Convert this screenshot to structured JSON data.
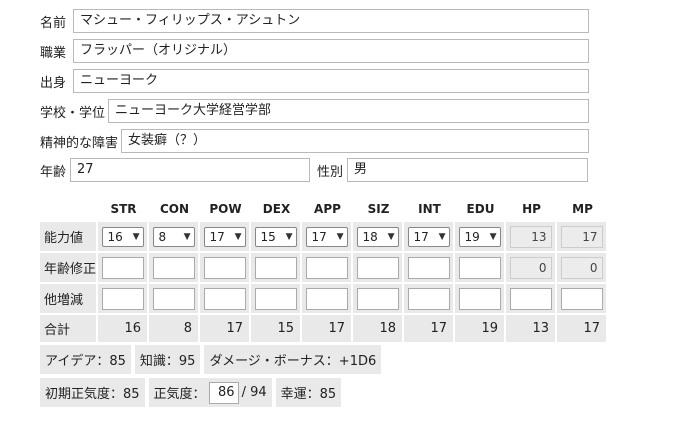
{
  "profile": {
    "name_label": "名前",
    "name_value": "マシュー・フィリップス・アシュトン",
    "job_label": "職業",
    "job_value": "フラッパー（オリジナル）",
    "origin_label": "出身",
    "origin_value": "ニューヨーク",
    "school_label": "学校・学位",
    "school_value": "ニューヨーク大学経営学部",
    "disorder_label": "精神的な障害",
    "disorder_value": "女装癖（？）",
    "age_label": "年齢",
    "age_value": "27",
    "sex_label": "性別",
    "sex_value": "男"
  },
  "stats": {
    "columns": [
      "STR",
      "CON",
      "POW",
      "DEX",
      "APP",
      "SIZ",
      "INT",
      "EDU",
      "HP",
      "MP"
    ],
    "row_labels": {
      "base": "能力値",
      "age_mod": "年齢修正",
      "other": "他増減",
      "total": "合計"
    },
    "base": [
      "16",
      "8",
      "17",
      "15",
      "17",
      "18",
      "17",
      "19",
      "13",
      "17"
    ],
    "age_mod_readonly": [
      "0",
      "0"
    ],
    "totals": [
      "16",
      "8",
      "17",
      "15",
      "17",
      "18",
      "17",
      "19",
      "13",
      "17"
    ]
  },
  "derived": {
    "idea": "アイデア：85",
    "know": "知識：95",
    "damage_bonus": "ダメージ・ボーナス：+1D6",
    "initial_san": "初期正気度：85",
    "san_label": "正気度：",
    "san_value": "86",
    "san_max": "/ 94",
    "luck": "幸運：85"
  },
  "icons": {
    "select_arrow": "chevron-down-icon"
  }
}
